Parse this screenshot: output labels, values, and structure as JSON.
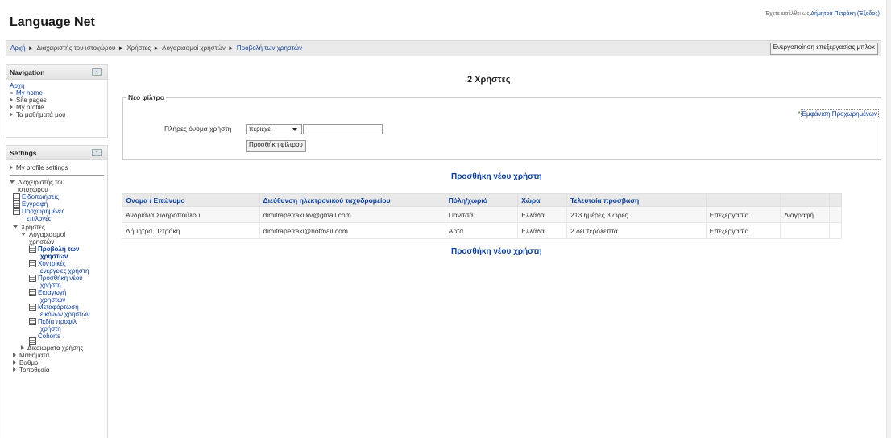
{
  "header": {
    "site_title": "Language Net",
    "logged_in_text": "Έχετε εισέλθει ως ",
    "user_link": "Δήμητρα Πετράκη",
    "logout_label": "(Έξοδος)"
  },
  "breadcrumb": {
    "items": [
      "Αρχή",
      "Διαχειριστής του ιστοχώρου",
      "Χρήστες",
      "Λογαριασμοί χρηστών",
      "Προβολή των χρηστών"
    ],
    "separator": "►"
  },
  "edit_blocks_button": "Ενεργοποίηση επεξεργασίας μπλοκ",
  "navigation_block": {
    "title": "Navigation",
    "toggle": "-",
    "home": "Αρχή",
    "items": [
      "My home",
      "Site pages",
      "My profile",
      "Τα μαθήματά μου"
    ]
  },
  "settings_block": {
    "title": "Settings",
    "toggle": "-",
    "profile_settings": "My profile settings",
    "site_admin": [
      "Διαχειριστής του",
      "ιστοχώρου"
    ],
    "notifications": "Ειδοποιήσεις",
    "registration": "Εγγραφή",
    "advanced": [
      "Προχωρημένες",
      "επιλογές"
    ],
    "users": "Χρήστες",
    "accounts": [
      "Λογαριασμοί",
      "χρηστών"
    ],
    "account_items": [
      [
        "Προβολή των",
        "χρηστών"
      ],
      [
        "Χοντρικές",
        "ενέργειες χρήστη"
      ],
      [
        "Προσθήκη νέου",
        "χρήστη"
      ],
      [
        "Εισαγωγή",
        "χρηστών"
      ],
      [
        "Μεταφόρτωση",
        "εικόνων χρηστών"
      ],
      [
        "Πεδία προφίλ",
        "χρήστη"
      ],
      [
        "Cohorts"
      ]
    ],
    "permissions": "Δικαιώματα χρήσης",
    "more": [
      "Μαθήματα",
      "Βαθμοί",
      "Τοποθεσία"
    ]
  },
  "main": {
    "heading": "2 Χρήστες",
    "filter_legend": "Νέο φίλτρο",
    "show_advanced": "Εμφάνιση Προχωρημένων",
    "fullname_label": "Πλήρες όνομα χρήστη",
    "operator_selected": "περιέχει",
    "filter_value": "",
    "add_filter_button": "Προσθήκη φίλτρου",
    "add_user_link": "Προσθήκη νέου χρήστη",
    "table": {
      "headers": [
        "Όνομα / Επώνυμο",
        "Διεύθυνση ηλεκτρονικού ταχυδρομείου",
        "Πόλη/χωριό",
        "Χώρα",
        "Τελευταία πρόσβαση",
        "",
        "",
        ""
      ],
      "rows": [
        [
          "Ανδριάνα Σιδηροπούλου",
          "dimitrapetraki.kv@gmail.com",
          "Γιανιτσά",
          "Ελλάδα",
          "213 ημέρες 3 ώρες",
          "Επεξεργασία",
          "Διαγραφή",
          ""
        ],
        [
          "Δήμητρα Πετράκη",
          "dimitrapetraki@hotmail.com",
          "Άρτα",
          "Ελλάδα",
          "2 δευτερόλεπτα",
          "Επεξεργασία",
          "",
          ""
        ]
      ]
    }
  }
}
